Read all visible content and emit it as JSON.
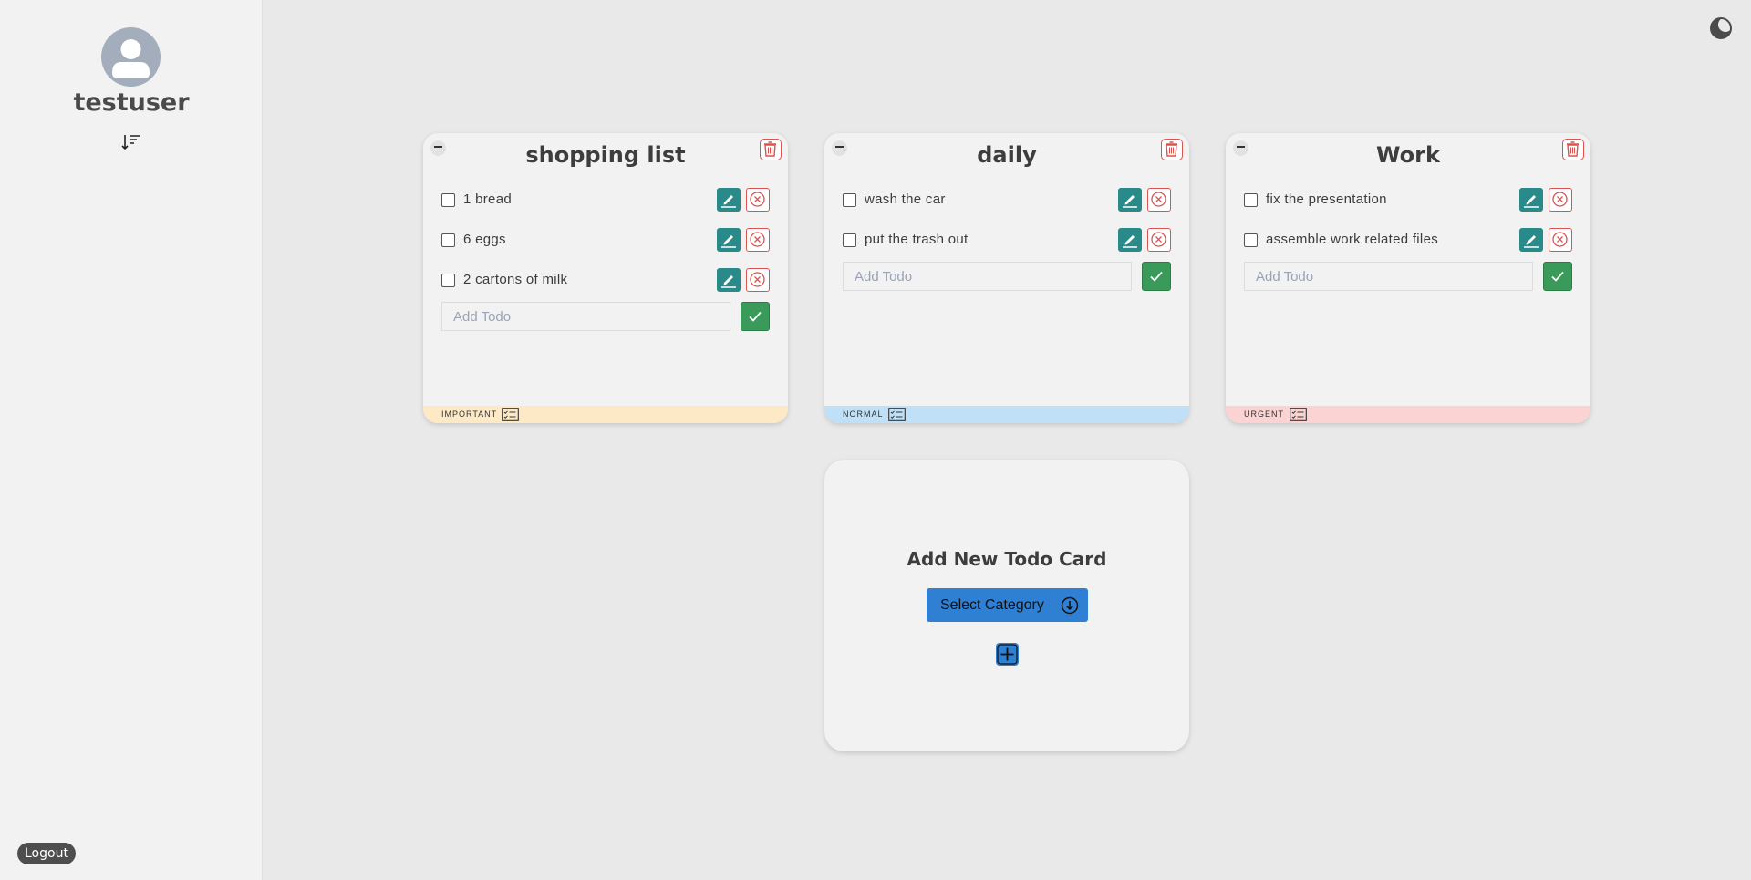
{
  "sidebar": {
    "username": "testuser",
    "logout_label": "Logout"
  },
  "cards": [
    {
      "title": "shopping list",
      "todos": [
        "1 bread",
        "6 eggs",
        "2 cartons of milk"
      ],
      "add_placeholder": "Add Todo",
      "category": "IMPORTANT",
      "category_color": "#fde9c6"
    },
    {
      "title": "daily",
      "todos": [
        "wash the car",
        "put the trash out"
      ],
      "add_placeholder": "Add Todo",
      "category": "NORMAL",
      "category_color": "#bfe0f7"
    },
    {
      "title": "Work",
      "todos": [
        "fix the presentation",
        "assemble work related files"
      ],
      "add_placeholder": "Add Todo",
      "category": "URGENT",
      "category_color": "#fbd3d3"
    }
  ],
  "new_card": {
    "title": "Add New Todo Card",
    "select_label": "Select Category"
  },
  "colors": {
    "edit": "#2a8a8a",
    "delete": "#d9534f",
    "confirm": "#3a9a5a",
    "accent": "#2f7fd3"
  }
}
